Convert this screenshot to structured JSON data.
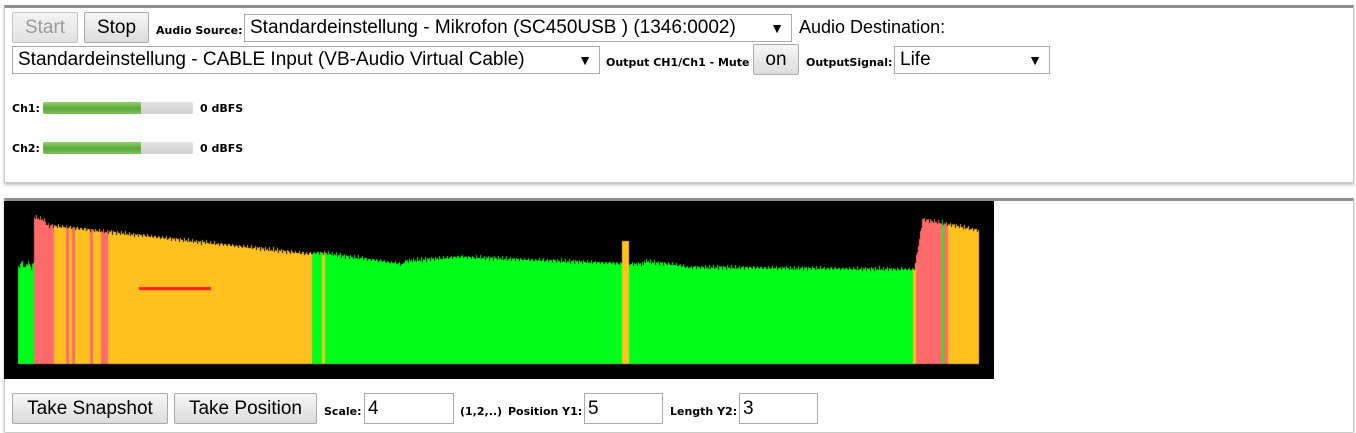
{
  "controls": {
    "start_label": "Start",
    "stop_label": "Stop",
    "audio_source_label": "Audio Source:",
    "audio_source_value": "Standardeinstellung - Mikrofon (SC450USB ) (1346:0002)",
    "audio_destination_label": "Audio Destination:",
    "audio_destination_value": "Standardeinstellung - CABLE Input (VB-Audio Virtual Cable)",
    "output_mute_label": "Output CH1/Ch1 - Mute",
    "mute_button_label": "on",
    "output_signal_label": "OutputSignal:",
    "output_signal_value": "Life",
    "dropdown_arrow": "▼"
  },
  "meters": [
    {
      "label": "Ch1:",
      "value_text": "0  dBFS",
      "level": 0.65
    },
    {
      "label": "Ch2:",
      "value_text": "0  dBFS",
      "level": 0.65
    }
  ],
  "snapshot": {
    "take_snapshot_label": "Take Snapshot",
    "take_position_label": "Take Position",
    "scale_label": "Scale:",
    "scale_value": "4",
    "scale_hint": "(1,2,..)",
    "position_label": "Position Y1:",
    "position_value": "5",
    "length_label": "Length Y2:",
    "length_value": "3"
  },
  "colors": {
    "scope_background": "#000000",
    "signal_normal": "#00ff1a",
    "signal_warning": "#ffc020",
    "signal_clip": "#ff6b6b",
    "marker": "#ff1a1a",
    "meter_fill": "#5aa83a"
  }
}
